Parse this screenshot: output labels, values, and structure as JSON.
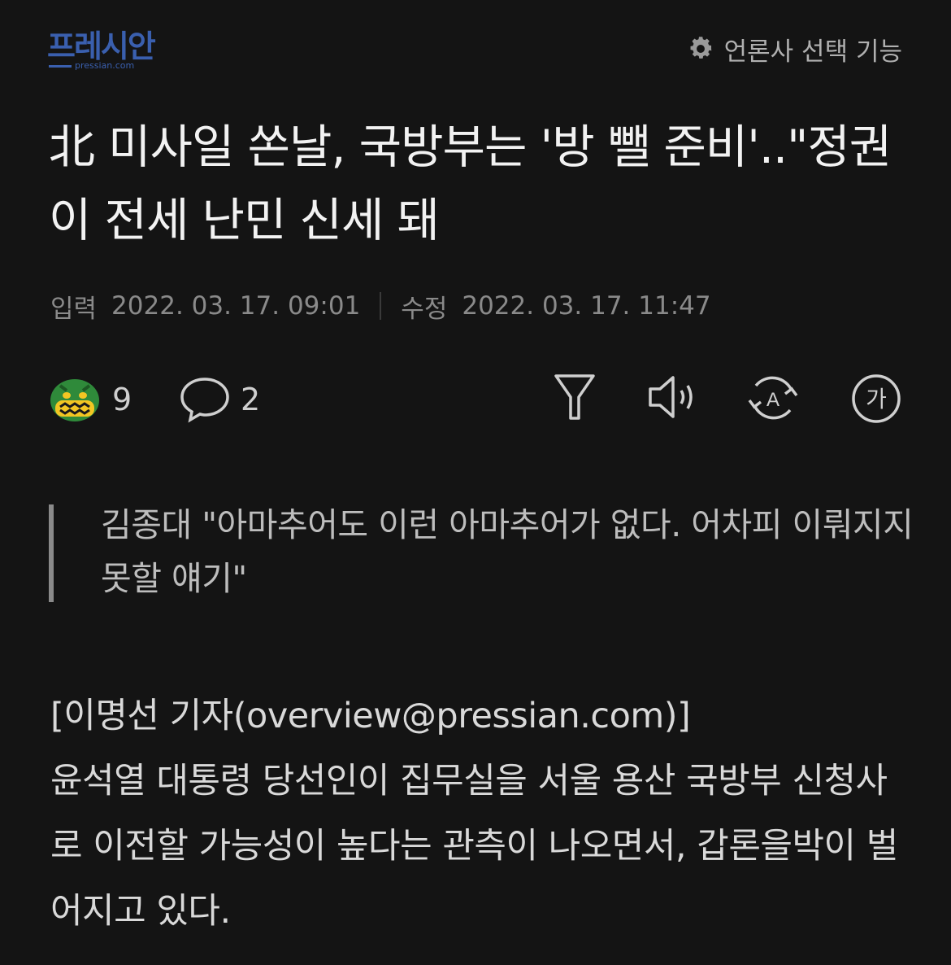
{
  "header": {
    "logo_text": "프레시안",
    "logo_sub": "pressian.com",
    "press_select_label": "언론사 선택 기능"
  },
  "article": {
    "title": "北 미사일 쏜날, 국방부는 '방 뺄 준비'..\"정권이 전세 난민 신세 돼",
    "input_label": "입력",
    "input_time": "2022. 03. 17. 09:01",
    "edit_label": "수정",
    "edit_time": "2022. 03. 17. 11:47",
    "reaction_count": "9",
    "comment_count": "2",
    "subtitle": "김종대 \"아마추어도 이런 아마추어가 없다. 어차피 이뤄지지 못할 얘기\"",
    "byline": "[이명선 기자(overview@pressian.com)]",
    "body": "윤석열 대통령 당선인이 집무실을 서울 용산 국방부 신청사로 이전할 가능성이 높다는 관측이 나오면서, 갑론을박이 벌어지고 있다."
  },
  "icons": {
    "settings": "gear-icon",
    "reaction": "angry-face-emoji-icon",
    "comment": "speech-bubble-icon",
    "filter": "funnel-icon",
    "audio": "speaker-icon",
    "translate": "translate-icon",
    "font_size": "font-size-icon",
    "font_size_glyph": "가",
    "translate_glyph": "A"
  },
  "colors": {
    "background": "#141414",
    "brand": "#3a5fae",
    "emoji_green": "#2f8a3a",
    "emoji_yellow": "#f3c623"
  }
}
